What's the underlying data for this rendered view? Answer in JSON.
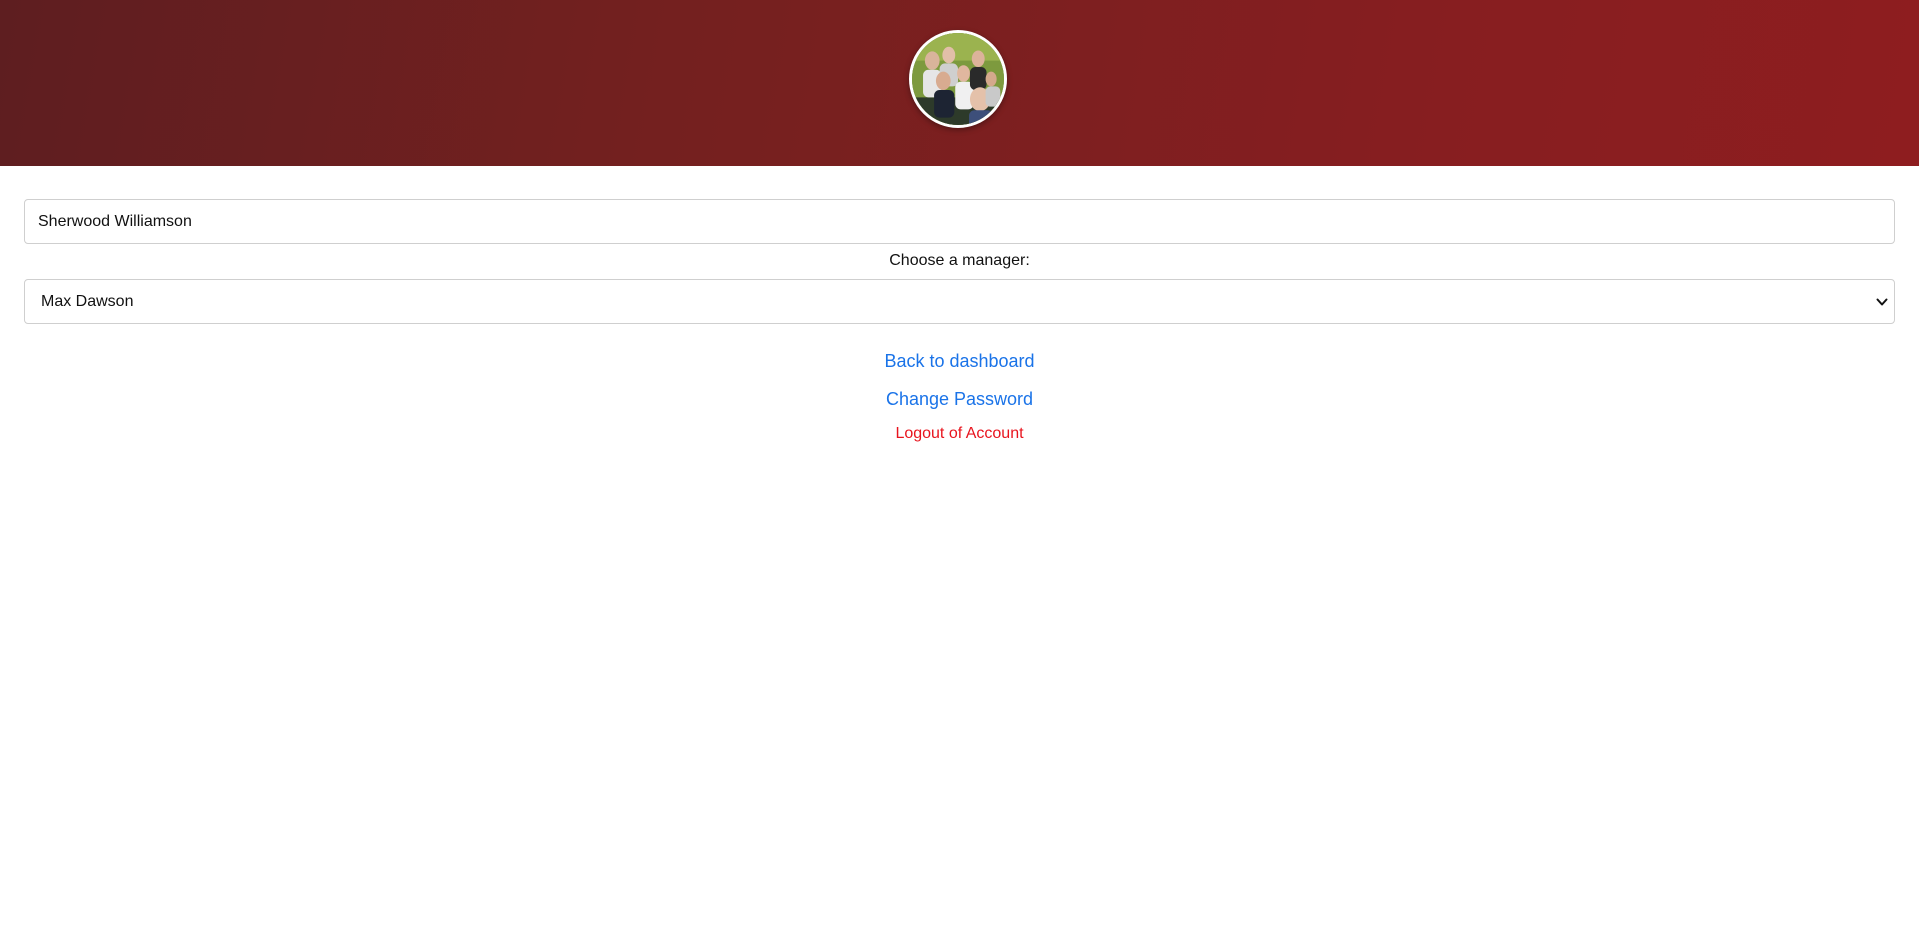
{
  "header": {
    "avatar_alt": "Group photo avatar"
  },
  "profile": {
    "name_value": "Sherwood Williamson",
    "manager_label": "Choose a manager:",
    "manager_selected": "Max Dawson"
  },
  "links": {
    "dashboard": "Back to dashboard",
    "change_password": "Change Password",
    "logout": "Logout of Account"
  },
  "colors": {
    "header_gradient_start": "#5e1e20",
    "header_gradient_end": "#8e1d1f",
    "link_blue": "#1a73e8",
    "logout_red": "#e8141e"
  },
  "icons": {
    "select_arrow": "chevron-down-icon"
  }
}
